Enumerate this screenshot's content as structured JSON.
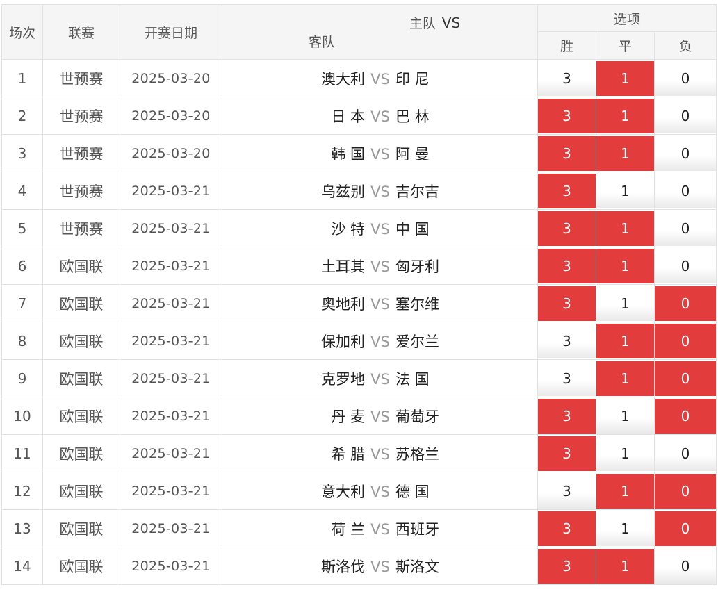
{
  "header": {
    "no": "场次",
    "league": "联赛",
    "date": "开赛日期",
    "home": "主队",
    "vs": "VS",
    "away": "客队",
    "options": "选项",
    "win": "胜",
    "draw": "平",
    "lose": "负"
  },
  "colors": {
    "selected": "#e23c3c",
    "unselected": "#ffffff"
  },
  "rows": [
    {
      "no": "1",
      "league": "世预赛",
      "date": "2025-03-20",
      "home": "澳大利",
      "vs": "VS",
      "away": "印 尼",
      "win": "3",
      "draw": "1",
      "lose": "0",
      "selected": [
        "draw"
      ]
    },
    {
      "no": "2",
      "league": "世预赛",
      "date": "2025-03-20",
      "home": "日 本",
      "vs": "VS",
      "away": "巴 林",
      "win": "3",
      "draw": "1",
      "lose": "0",
      "selected": [
        "win",
        "draw"
      ]
    },
    {
      "no": "3",
      "league": "世预赛",
      "date": "2025-03-20",
      "home": "韩 国",
      "vs": "VS",
      "away": "阿 曼",
      "win": "3",
      "draw": "1",
      "lose": "0",
      "selected": [
        "win",
        "draw"
      ]
    },
    {
      "no": "4",
      "league": "世预赛",
      "date": "2025-03-21",
      "home": "乌兹别",
      "vs": "VS",
      "away": "吉尔吉",
      "win": "3",
      "draw": "1",
      "lose": "0",
      "selected": [
        "win"
      ]
    },
    {
      "no": "5",
      "league": "世预赛",
      "date": "2025-03-21",
      "home": "沙 特",
      "vs": "VS",
      "away": "中 国",
      "win": "3",
      "draw": "1",
      "lose": "0",
      "selected": [
        "win",
        "draw"
      ]
    },
    {
      "no": "6",
      "league": "欧国联",
      "date": "2025-03-21",
      "home": "土耳其",
      "vs": "VS",
      "away": "匈牙利",
      "win": "3",
      "draw": "1",
      "lose": "0",
      "selected": [
        "win",
        "draw"
      ]
    },
    {
      "no": "7",
      "league": "欧国联",
      "date": "2025-03-21",
      "home": "奥地利",
      "vs": "VS",
      "away": "塞尔维",
      "win": "3",
      "draw": "1",
      "lose": "0",
      "selected": [
        "win",
        "lose"
      ]
    },
    {
      "no": "8",
      "league": "欧国联",
      "date": "2025-03-21",
      "home": "保加利",
      "vs": "VS",
      "away": "爱尔兰",
      "win": "3",
      "draw": "1",
      "lose": "0",
      "selected": [
        "draw",
        "lose"
      ]
    },
    {
      "no": "9",
      "league": "欧国联",
      "date": "2025-03-21",
      "home": "克罗地",
      "vs": "VS",
      "away": "法 国",
      "win": "3",
      "draw": "1",
      "lose": "0",
      "selected": [
        "draw",
        "lose"
      ]
    },
    {
      "no": "10",
      "league": "欧国联",
      "date": "2025-03-21",
      "home": "丹 麦",
      "vs": "VS",
      "away": "葡萄牙",
      "win": "3",
      "draw": "1",
      "lose": "0",
      "selected": [
        "win",
        "lose"
      ]
    },
    {
      "no": "11",
      "league": "欧国联",
      "date": "2025-03-21",
      "home": "希 腊",
      "vs": "VS",
      "away": "苏格兰",
      "win": "3",
      "draw": "1",
      "lose": "0",
      "selected": [
        "win"
      ]
    },
    {
      "no": "12",
      "league": "欧国联",
      "date": "2025-03-21",
      "home": "意大利",
      "vs": "VS",
      "away": "德 国",
      "win": "3",
      "draw": "1",
      "lose": "0",
      "selected": [
        "draw",
        "lose"
      ]
    },
    {
      "no": "13",
      "league": "欧国联",
      "date": "2025-03-21",
      "home": "荷 兰",
      "vs": "VS",
      "away": "西班牙",
      "win": "3",
      "draw": "1",
      "lose": "0",
      "selected": [
        "win",
        "lose"
      ]
    },
    {
      "no": "14",
      "league": "欧国联",
      "date": "2025-03-21",
      "home": "斯洛伐",
      "vs": "VS",
      "away": "斯洛文",
      "win": "3",
      "draw": "1",
      "lose": "0",
      "selected": [
        "win",
        "draw"
      ]
    }
  ]
}
